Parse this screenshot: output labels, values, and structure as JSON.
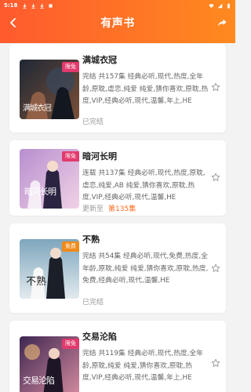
{
  "status_bar": {
    "time": "5:18",
    "icons": [
      "download-icon",
      "download-icon",
      "download-icon",
      "notification-icon"
    ],
    "right_icons": [
      "wifi-icon",
      "signal-icon",
      "battery-icon"
    ]
  },
  "header": {
    "title": "有声书",
    "back_icon": "chevron-left-icon",
    "share_icon": "share-arrow-icon",
    "gradient": [
      "#ff5a2e",
      "#ff8a1f"
    ]
  },
  "books": [
    {
      "title": "满城衣冠",
      "badge": "限免",
      "badge_kind": "limit",
      "info": "完结   共157集    经典必听,现代,热度,全年龄,原耽,虐恋,纯爱    纯爱,猜你喜欢,原耽,热度,VIP,经典必听,现代,温馨,年上,HE",
      "status": "已完结",
      "status_highlight": "",
      "cover_text": "满城衣冠",
      "cover_colors": [
        "#2a3240",
        "#8b5a3c"
      ]
    },
    {
      "title": "暗河长明",
      "badge": "限免",
      "badge_kind": "limit",
      "info": "连载   共137集    经典必听,现代,热度,原耽,虐恋,纯爱,AB    纯爱,猜你喜欢,原耽,热度,VIP,经典必听,现代,温馨,HE",
      "status": "更新至",
      "status_highlight": "第135集",
      "cover_text": "暗河长明",
      "cover_colors": [
        "#c9a6d8",
        "#e8c7e0"
      ]
    },
    {
      "title": "不熟",
      "badge": "免费",
      "badge_kind": "free",
      "info": "完结   共54集     经典必听,现代,免费,热度,全年龄,原耽,纯爱    纯爱,猜你喜欢,原耽,热度,免费,经典必听,现代,温馨,HE",
      "status": "已完结",
      "status_highlight": "",
      "cover_text": "不熟",
      "cover_colors": [
        "#8fb4c8",
        "#d8e4ea"
      ]
    },
    {
      "title": "交易沦陷",
      "badge": "限免",
      "badge_kind": "limit",
      "info": "完结   共119集    经典必听,现代,热度,全年龄,原耽,纯爱    纯爱,猜你喜欢,原耽,热度,VIP,经典必听,现代,温馨,年上,HE",
      "status": "",
      "status_highlight": "",
      "cover_text": "交易沦陷",
      "cover_colors": [
        "#5a3a6a",
        "#d48aa0"
      ]
    }
  ],
  "accent_color": "#ff6a1f",
  "star_icon": "star-outline-icon"
}
